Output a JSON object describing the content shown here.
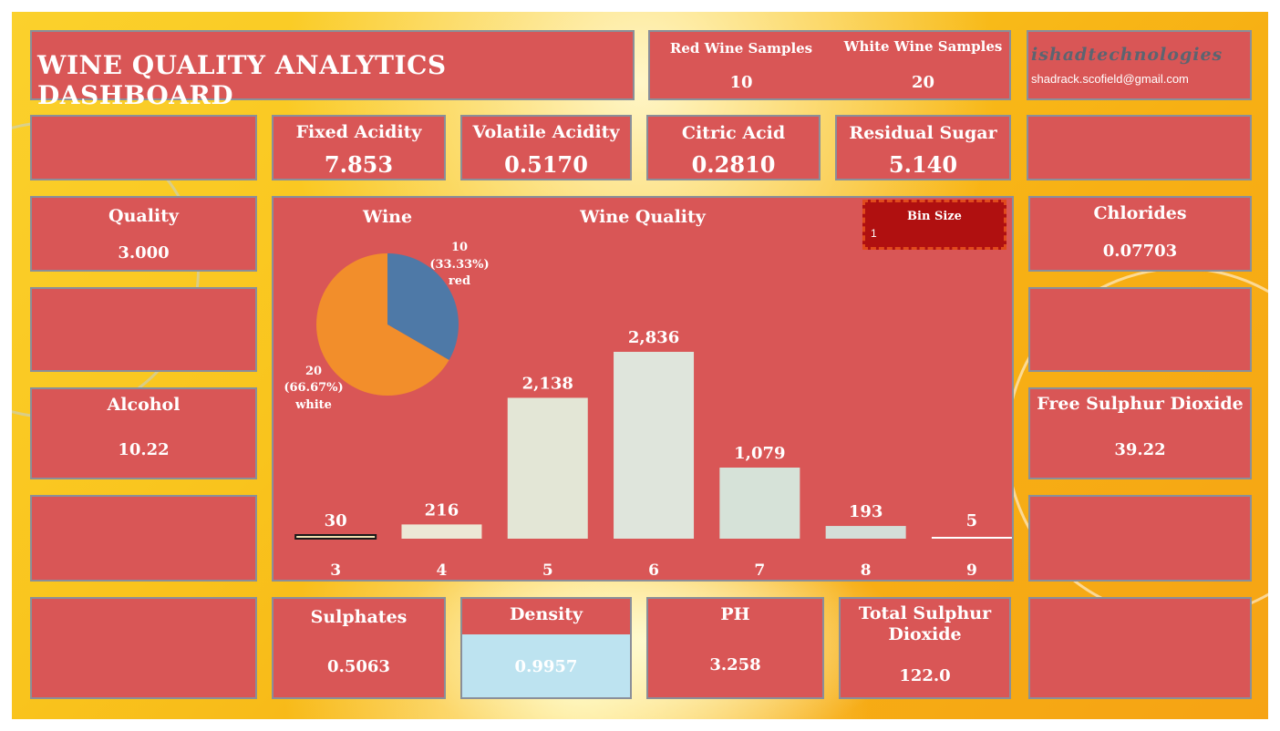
{
  "header": {
    "title": "WINE QUALITY ANALYTICS DASHBOARD"
  },
  "samples": {
    "red_label": "Red Wine Samples",
    "red_value": "10",
    "white_label": "White Wine Samples",
    "white_value": "20"
  },
  "brand": {
    "logo_text": "ishadtechnologies",
    "email": "shadrack.scofield@gmail.com"
  },
  "kpis": {
    "fixed_acidity": {
      "label": "Fixed Acidity",
      "value": "7.853"
    },
    "volatile_acidity": {
      "label": "Volatile Acidity",
      "value": "0.5170"
    },
    "citric_acid": {
      "label": "Citric Acid",
      "value": "0.2810"
    },
    "residual_sugar": {
      "label": "Residual Sugar",
      "value": "5.140"
    },
    "quality": {
      "label": "Quality",
      "value": "3.000"
    },
    "alcohol": {
      "label": "Alcohol",
      "value": "10.22"
    },
    "chlorides": {
      "label": "Chlorides",
      "value": "0.07703"
    },
    "free_sulphur": {
      "label": "Free Sulphur Dioxide",
      "value": "39.22"
    },
    "sulphates": {
      "label": "Sulphates",
      "value": "0.5063"
    },
    "density": {
      "label": "Density",
      "value": "0.9957"
    },
    "ph": {
      "label": "PH",
      "value": "3.258"
    },
    "total_sulphur": {
      "label": "Total Sulphur Dioxide",
      "value": "122.0"
    }
  },
  "bin": {
    "label": "Bin Size",
    "value": "1"
  },
  "colors": {
    "card": "#d95656",
    "border": "#8a8f99",
    "bin_bg": "#b01010",
    "density_highlight": "#bde3f0",
    "pie_red": "#4e79a7",
    "pie_white": "#f28e2b"
  },
  "chart_data": [
    {
      "type": "pie",
      "title": "Wine",
      "slices": [
        {
          "label": "red",
          "value": 10,
          "display": "10",
          "percent": "(33.33%)",
          "color": "#4e79a7"
        },
        {
          "label": "white",
          "value": 20,
          "display": "20",
          "percent": "(66.67%)",
          "color": "#f28e2b"
        }
      ]
    },
    {
      "type": "bar",
      "title": "Wine Quality",
      "categories": [
        "3",
        "4",
        "5",
        "6",
        "7",
        "8",
        "9"
      ],
      "values": [
        30,
        216,
        2138,
        2836,
        1079,
        193,
        5
      ],
      "value_labels": [
        "30",
        "216",
        "2,138",
        "2,836",
        "1,079",
        "193",
        "5"
      ],
      "xlabel": "",
      "ylabel": "",
      "ylim": [
        0,
        2836
      ],
      "grid": false
    }
  ]
}
